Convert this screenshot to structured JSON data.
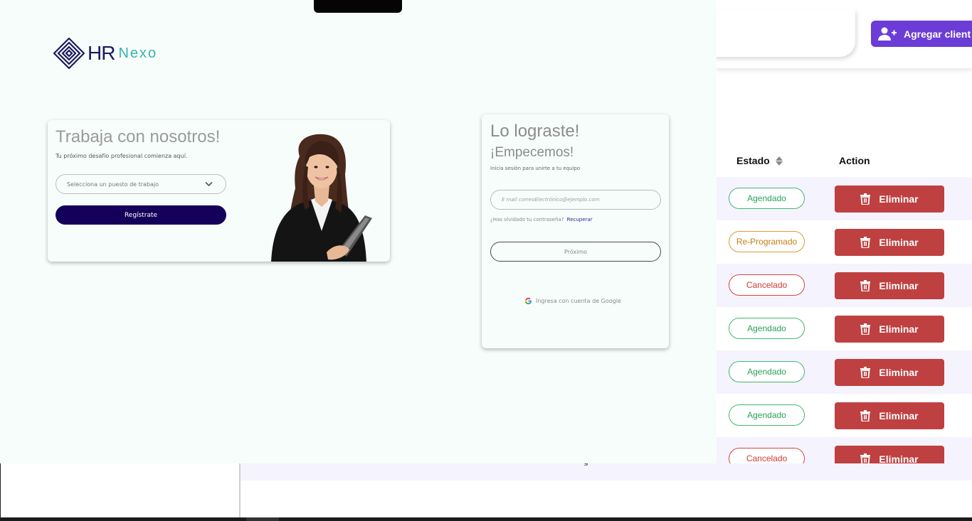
{
  "background": {
    "add_client_label": "Agregar client",
    "table": {
      "headers": {
        "status": "Estado",
        "action": "Action"
      },
      "rows": [
        {
          "status": "Agendado",
          "status_type": "agendado",
          "action": "Eliminar"
        },
        {
          "status": "Re-Programado",
          "status_type": "reprog",
          "action": "Eliminar"
        },
        {
          "status": "Cancelado",
          "status_type": "cancel",
          "action": "Eliminar"
        },
        {
          "status": "Agendado",
          "status_type": "agendado",
          "action": "Eliminar"
        },
        {
          "status": "Agendado",
          "status_type": "agendado",
          "action": "Eliminar"
        },
        {
          "status": "Agendado",
          "status_type": "agendado",
          "action": "Eliminar"
        },
        {
          "status": "Cancelado",
          "status_type": "cancel",
          "action": "Eliminar"
        }
      ],
      "bottom_fragment": "g"
    },
    "colors": {
      "accent_purple": "#6c3cd6",
      "delete_red": "#bf4040",
      "status_agendado": "#2aa25a",
      "status_reprogramado": "#c27f12",
      "status_cancelado": "#d13a32"
    }
  },
  "overlay": {
    "logo": {
      "hr": "HR",
      "nexo": "Nexo"
    },
    "join_card": {
      "title": "Trabaja con nosotros!",
      "subtitle": "Tu próximo desafío profesional comienza aquí.",
      "select_placeholder": "Selecciona un puesto de trabajo",
      "register_label": "Regístrate"
    },
    "login_card": {
      "title": "Lo lograste!",
      "subtitle": "¡Empecemos!",
      "hint": "Inicia sesión para unirte a tu equipo",
      "email_placeholder": "E mail correoElectrónico@ejemplo.com",
      "forgot_text": "¿Has olvidado tu contraseña?",
      "recover_link": "Recuperar",
      "next_label": "Próximo",
      "google_label": "Ingresa con cuenta de Google"
    },
    "colors": {
      "brand_navy": "#14005a",
      "brand_teal": "#3ab3aa",
      "background": "#f7fdfb"
    }
  }
}
